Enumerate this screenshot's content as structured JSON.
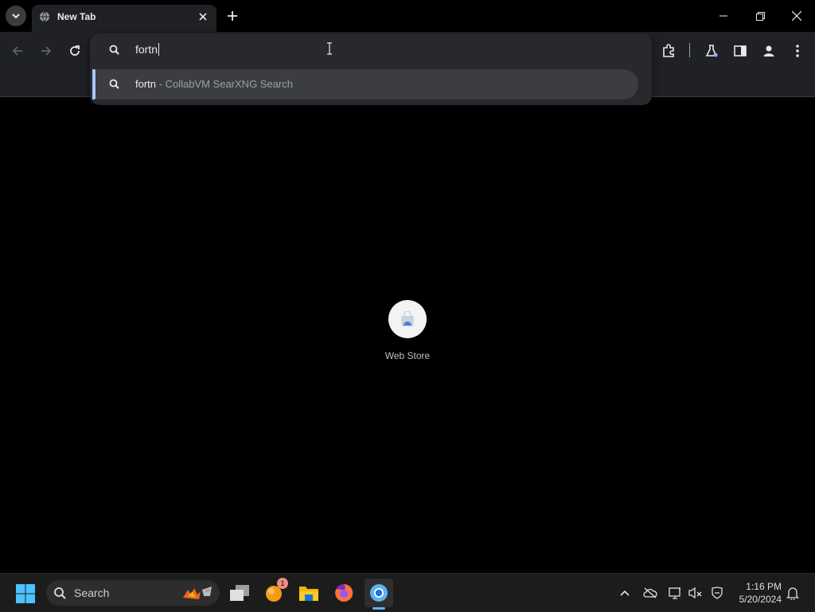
{
  "tab": {
    "title": "New Tab"
  },
  "omnibox": {
    "value": "fortn"
  },
  "suggestion": {
    "query": "fortn",
    "separator": " - ",
    "description": "CollabVM SearXNG Search"
  },
  "shortcut": {
    "label": "Web Store"
  },
  "taskbar": {
    "search_label": "Search",
    "notification_count": "1",
    "time": "1:16 PM",
    "date": "5/20/2024"
  },
  "colors": {
    "accent": "#a8c7fa",
    "taskbar_active": "#5fb2f2",
    "toolbar": "#202124"
  }
}
